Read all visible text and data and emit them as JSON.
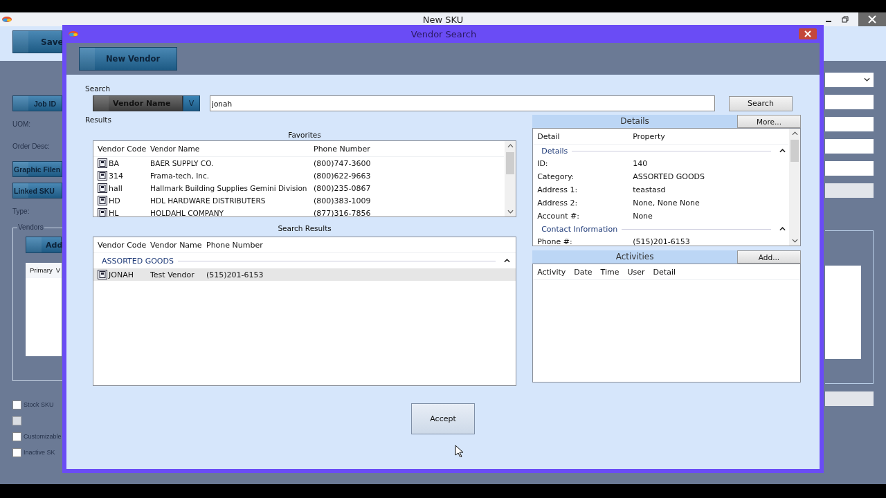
{
  "window": {
    "title": "New SKU"
  },
  "main_form": {
    "save_button": "Save",
    "left_items": [
      {
        "kind": "button",
        "label": "Job ID"
      },
      {
        "kind": "label",
        "label": "UOM:"
      },
      {
        "kind": "label",
        "label": "Order Desc:"
      },
      {
        "kind": "button",
        "label": "Graphic Filen"
      },
      {
        "kind": "button",
        "label": "Linked SKU"
      },
      {
        "kind": "label",
        "label": "Type:"
      }
    ],
    "vendors_group": {
      "title": "Vendors",
      "add_button": "Add",
      "columns": [
        "Primary",
        "V"
      ]
    },
    "checkboxes": [
      {
        "label": "Stock SKU",
        "checked": false,
        "disabled": false
      },
      {
        "checked": false,
        "disabled": true
      },
      {
        "label": "Customizable",
        "checked": false,
        "disabled": false
      },
      {
        "label": "Inactive SK",
        "checked": false,
        "disabled": false
      }
    ],
    "right_fields": [
      {
        "kind": "dropdown",
        "disabled": false
      },
      {
        "kind": "text",
        "disabled": false
      },
      {
        "kind": "text",
        "disabled": false
      },
      {
        "kind": "text",
        "disabled": false
      },
      {
        "kind": "text",
        "disabled": false
      },
      {
        "kind": "text",
        "disabled": true
      }
    ]
  },
  "dialog": {
    "title": "Vendor Search",
    "toolbar_button": "New Vendor",
    "search": {
      "label": "Search",
      "field_selector": "Vendor Name",
      "selector_caret": "V",
      "value": "jonah",
      "button": "Search"
    },
    "results_label": "Results",
    "favorites": {
      "title": "Favorites",
      "columns": [
        "Vendor Code",
        "Vendor Name",
        "Phone Number"
      ],
      "rows": [
        {
          "code": "BA",
          "name": "BAER SUPPLY CO.",
          "phone": "(800)747-3600",
          "selected": false
        },
        {
          "code": "314",
          "name": "Frama-tech, Inc.",
          "phone": "(800)622-9663",
          "selected": false
        },
        {
          "code": "hall",
          "name": "Hallmark Building Supplies Gemini Division",
          "phone": "(800)235-0867",
          "selected": false
        },
        {
          "code": "HD",
          "name": "HDL HARDWARE DISTRIBUTERS",
          "phone": "(800)383-1009",
          "selected": false
        },
        {
          "code": "HL",
          "name": "HOLDAHL COMPANY",
          "phone": "(877)316-7856",
          "selected": false
        }
      ]
    },
    "search_results": {
      "title": "Search Results",
      "columns": [
        "Vendor Code",
        "Vendor Name",
        "Phone Number"
      ],
      "groups": [
        {
          "name": "ASSORTED GOODS",
          "expanded": true,
          "rows": [
            {
              "code": "JONAH",
              "name": "Test Vendor",
              "phone": "(515)201-6153",
              "selected": true
            }
          ]
        }
      ]
    },
    "details": {
      "title": "Details",
      "button": "More...",
      "columns": [
        "Detail",
        "Property"
      ],
      "groups": [
        {
          "name": "Details",
          "expanded": true,
          "rows": [
            {
              "label": "ID:",
              "value": "140"
            },
            {
              "label": "Category:",
              "value": "ASSORTED GOODS"
            },
            {
              "label": "Address 1:",
              "value": "teastasd"
            },
            {
              "label": "Address 2:",
              "value": "None, None None"
            },
            {
              "label": "Account #:",
              "value": "None"
            }
          ]
        },
        {
          "name": "Contact Information",
          "expanded": true,
          "rows": [
            {
              "label": "Phone #:",
              "value": "(515)201-6153"
            }
          ]
        }
      ]
    },
    "activities": {
      "title": "Activities",
      "button": "Add...",
      "columns": [
        "Activity",
        "Date",
        "Time",
        "User",
        "Detail"
      ]
    },
    "accept_button": "Accept"
  }
}
